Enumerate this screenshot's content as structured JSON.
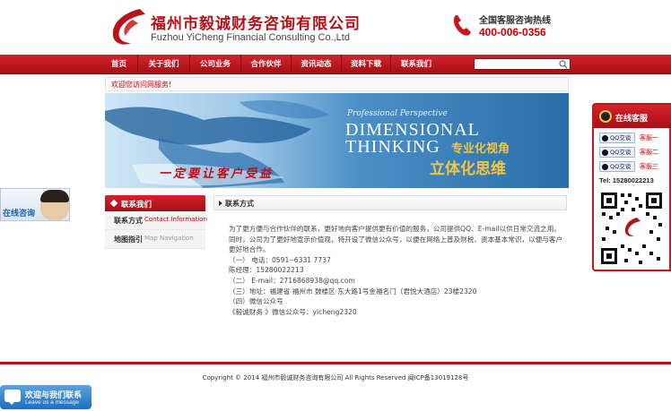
{
  "header": {
    "company_cn": "福州市毅诚财务咨询有限公司",
    "company_en": "Fuzhou YiCheng Financial Consulting Co.,Ltd",
    "hotline_label": "全国客服咨询热线",
    "hotline_number": "400-006-0356"
  },
  "nav": {
    "items": [
      "首页",
      "关于我们",
      "公司业务",
      "合作伙伴",
      "资讯动态",
      "资料下载",
      "联系我们"
    ],
    "search_placeholder": ""
  },
  "welcome": "欢迎您访问网服务!",
  "banner": {
    "subtitle": "Professional Perspective",
    "line1": "DIMENSIONAL",
    "line2": "THINKING",
    "cn1": "专业化视角",
    "cn2": "立体化思维",
    "slogan": "一定要让客户受益"
  },
  "sidebar": {
    "title": "联系我们",
    "items": [
      {
        "cn": "联系方式",
        "en": "Contact Information"
      },
      {
        "cn": "地图指引",
        "en": "Map Navigation"
      }
    ]
  },
  "main": {
    "title": "联系方式",
    "paragraphs": [
      "为了更方便与合作伙伴的联系，更好地向客户提供更有价值的服务，公司提供QQ、E-mail以供日常交流之用。",
      "同时，公司为了更好地宣示价值观，特开设了微信公众号，以便在网络上普及财税、资本基本常识，以便与客户",
      "更好地合作。",
      "（一）  电话：0591--6331 7737",
      "            陈经理：15280022213",
      "（二）  E-mail：2716868938@qq.com",
      "（三）地址：福建省 福州市 鼓楼区  东大路1号金福名门（君悦大酒店）23楼2320",
      "（四）微信公众号",
      "      《毅诚财务 》微信公众号：yicheng2320"
    ]
  },
  "footer": "Copyright © 2014 福州市毅诚财务咨询有限公司 All Rights Reserved 闽ICP备13019128号",
  "online_service": {
    "title": "在线客服",
    "qq_label": "QQ交谈",
    "agents": [
      "客服一",
      "客服二",
      "客服三"
    ],
    "tel": "Tel: 15280022213"
  },
  "left_float": {
    "label": "在线咨询"
  },
  "bottom_float": {
    "cn": "欢迎与我们联系",
    "en": "Leave us a message"
  }
}
